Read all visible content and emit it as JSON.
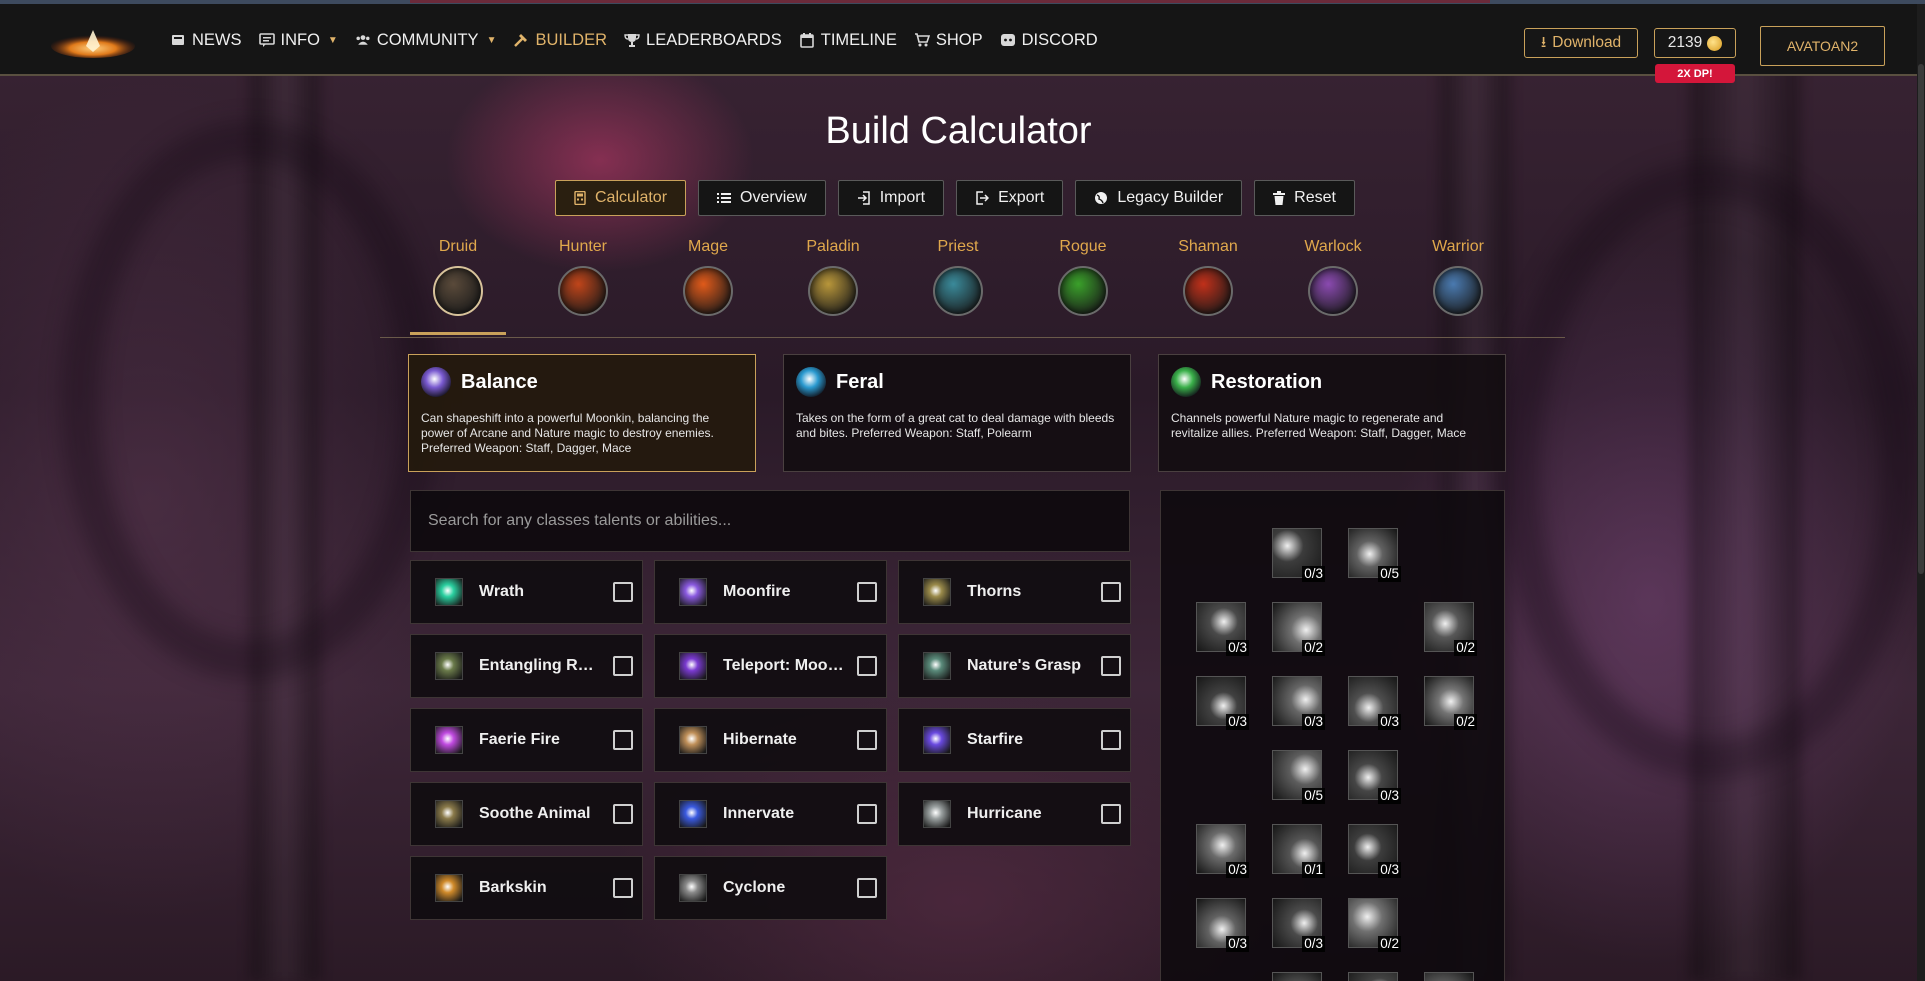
{
  "nav": {
    "items": [
      {
        "label": "NEWS",
        "icon": "news-icon",
        "caret": false,
        "active": false
      },
      {
        "label": "INFO",
        "icon": "info-icon",
        "caret": true,
        "active": false
      },
      {
        "label": "COMMUNITY",
        "icon": "community-icon",
        "caret": true,
        "active": false
      },
      {
        "label": "BUILDER",
        "icon": "hammer-icon",
        "caret": false,
        "active": true
      },
      {
        "label": "LEADERBOARDS",
        "icon": "trophy-icon",
        "caret": false,
        "active": false
      },
      {
        "label": "TIMELINE",
        "icon": "calendar-icon",
        "caret": false,
        "active": false
      },
      {
        "label": "SHOP",
        "icon": "cart-icon",
        "caret": false,
        "active": false
      },
      {
        "label": "DISCORD",
        "icon": "discord-icon",
        "caret": false,
        "active": false
      }
    ],
    "download_label": "Download",
    "dp_amount": "2139",
    "dp_badge": "2X DP!",
    "username": "AVATOAN2"
  },
  "page": {
    "title": "Build Calculator"
  },
  "actions": [
    {
      "label": "Calculator",
      "icon": "calculator-icon",
      "active": true
    },
    {
      "label": "Overview",
      "icon": "list-icon",
      "active": false
    },
    {
      "label": "Import",
      "icon": "import-icon",
      "active": false
    },
    {
      "label": "Export",
      "icon": "export-icon",
      "active": false
    },
    {
      "label": "Legacy Builder",
      "icon": "globe-icon",
      "active": false
    },
    {
      "label": "Reset",
      "icon": "trash-icon",
      "active": false
    }
  ],
  "classes": [
    {
      "name": "Druid",
      "active": true,
      "color": "#5a4a3a"
    },
    {
      "name": "Hunter",
      "active": false,
      "color": "#c0451a"
    },
    {
      "name": "Mage",
      "active": false,
      "color": "#e05a1a"
    },
    {
      "name": "Paladin",
      "active": false,
      "color": "#b8963a"
    },
    {
      "name": "Priest",
      "active": false,
      "color": "#3a8a9a"
    },
    {
      "name": "Rogue",
      "active": false,
      "color": "#3aa02a"
    },
    {
      "name": "Shaman",
      "active": false,
      "color": "#c0301a"
    },
    {
      "name": "Warlock",
      "active": false,
      "color": "#8a4ab0"
    },
    {
      "name": "Warrior",
      "active": false,
      "color": "#4a7ab0"
    }
  ],
  "specs": [
    {
      "name": "Balance",
      "active": true,
      "icon_color": "#7a5ad0",
      "desc": "Can shapeshift into a powerful Moonkin, balancing the power of Arcane and Nature magic to destroy enemies. Preferred Weapon: Staff, Dagger, Mace"
    },
    {
      "name": "Feral",
      "active": false,
      "icon_color": "#2a9ad0",
      "desc": "Takes on the form of a great cat to deal damage with bleeds and bites. Preferred Weapon: Staff, Polearm"
    },
    {
      "name": "Restoration",
      "active": false,
      "icon_color": "#3ab04a",
      "desc": "Channels powerful Nature magic to regenerate and revitalize allies. Preferred Weapon: Staff, Dagger, Mace"
    }
  ],
  "search": {
    "placeholder": "Search for any classes talents or abilities..."
  },
  "abilities": [
    {
      "name": "Wrath",
      "color": "#2ad0a0"
    },
    {
      "name": "Moonfire",
      "color": "#8a5ae0"
    },
    {
      "name": "Thorns",
      "color": "#9a8a4a"
    },
    {
      "name": "Entangling Roots",
      "color": "#6a7a4a"
    },
    {
      "name": "Teleport: Moonglade",
      "color": "#7a3ad0"
    },
    {
      "name": "Nature's Grasp",
      "color": "#5a8a7a"
    },
    {
      "name": "Faerie Fire",
      "color": "#c04ae0"
    },
    {
      "name": "Hibernate",
      "color": "#c0905a"
    },
    {
      "name": "Starfire",
      "color": "#6a4ae0"
    },
    {
      "name": "Soothe Animal",
      "color": "#8a7a4a"
    },
    {
      "name": "Innervate",
      "color": "#3a5ae0"
    },
    {
      "name": "Hurricane",
      "color": "#9aa0a0"
    },
    {
      "name": "Barkskin",
      "color": "#d08a2a"
    },
    {
      "name": "Cyclone",
      "color": "#8a8a8a"
    }
  ],
  "talents": [
    {
      "rank": "0/3"
    },
    {
      "rank": "0/5"
    },
    {
      "rank": "0/3"
    },
    {
      "rank": "0/2"
    },
    {
      "rank": "0/2"
    },
    {
      "rank": "0/3"
    },
    {
      "rank": "0/3"
    },
    {
      "rank": "0/3"
    },
    {
      "rank": "0/2"
    },
    {
      "rank": "0/5"
    },
    {
      "rank": "0/3"
    },
    {
      "rank": "0/3"
    },
    {
      "rank": "0/1"
    },
    {
      "rank": "0/3"
    },
    {
      "rank": "0/3"
    },
    {
      "rank": "0/3"
    },
    {
      "rank": "0/2"
    },
    {
      "rank": ""
    },
    {
      "rank": ""
    },
    {
      "rank": ""
    }
  ]
}
